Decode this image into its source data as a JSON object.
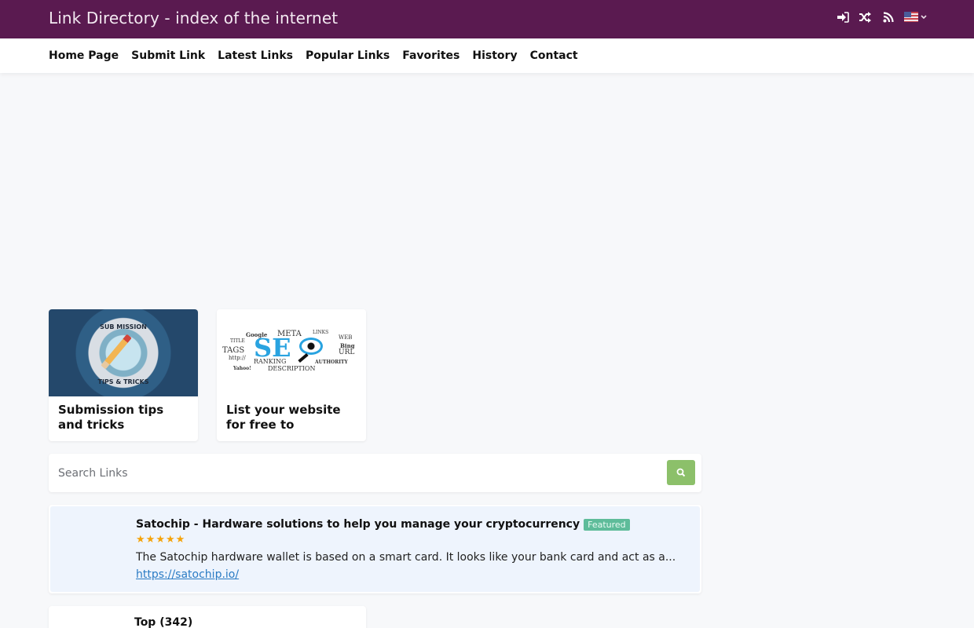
{
  "header": {
    "site_title": "Link Directory - index of the internet",
    "icons": [
      "sign-in-icon",
      "random-icon",
      "rss-icon",
      "us-flag-icon",
      "chevron-down-icon"
    ],
    "language": "English (US)"
  },
  "nav": {
    "items": [
      {
        "label": "Home Page"
      },
      {
        "label": "Submit Link"
      },
      {
        "label": "Latest Links"
      },
      {
        "label": "Popular Links"
      },
      {
        "label": "Favorites"
      },
      {
        "label": "History"
      },
      {
        "label": "Contact"
      }
    ]
  },
  "articles": [
    {
      "title": "Submission tips and tricks",
      "image_text_top": "SUB MISSION",
      "image_text_bottom": "TIPS & TRICKS"
    },
    {
      "title": "List your website for free to improve...",
      "image_words": {
        "big": "SE",
        "words": [
          "Google",
          "META",
          "LINKS",
          "WEB",
          "TITLE",
          "Bing",
          "TAGS",
          "URL",
          "http://",
          "RANKING",
          "AUTHORITY",
          "Yahoo!",
          "DESCRIPTION"
        ]
      }
    }
  ],
  "search": {
    "placeholder": "Search Links",
    "value": ""
  },
  "featured_link": {
    "title": "Satochip - Hardware solutions to help you manage your cryptocurrency",
    "badge": "Featured",
    "rating": 5,
    "rating_max": 5,
    "description": "The Satochip hardware wallet is based on a smart card. It looks like your bank card and act as a...",
    "url": "https://satochip.io/"
  },
  "categories": [
    {
      "label": "Top (342)"
    }
  ],
  "colors": {
    "header_bg": "#5a1a50",
    "accent_green": "#8cc06a",
    "badge_green": "#5ebc9a",
    "star": "#f5a30a",
    "link": "#2a7bc4"
  }
}
